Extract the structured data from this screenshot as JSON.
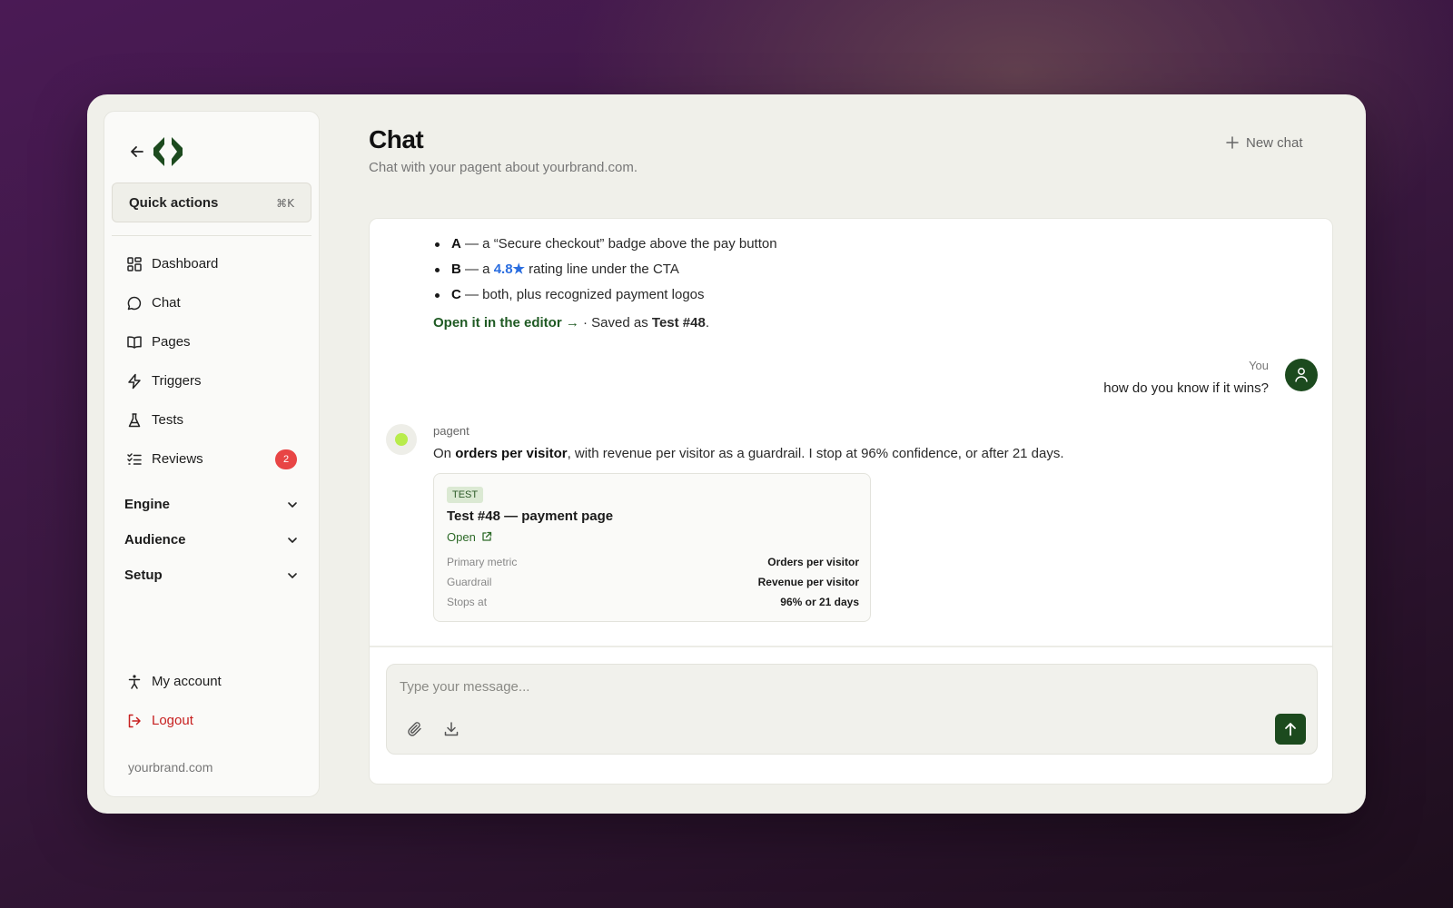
{
  "sidebar": {
    "quick_actions": {
      "label": "Quick actions",
      "shortcut": "⌘K"
    },
    "nav": [
      {
        "label": "Dashboard",
        "icon": "dashboard-icon"
      },
      {
        "label": "Chat",
        "icon": "chat-bubble-icon"
      },
      {
        "label": "Pages",
        "icon": "book-icon"
      },
      {
        "label": "Triggers",
        "icon": "lightning-icon"
      },
      {
        "label": "Tests",
        "icon": "flask-icon"
      },
      {
        "label": "Reviews",
        "icon": "checklist-icon",
        "badge": "2"
      }
    ],
    "sections": [
      {
        "label": "Engine"
      },
      {
        "label": "Audience"
      },
      {
        "label": "Setup"
      }
    ],
    "my_account": "My account",
    "logout": "Logout",
    "domain": "yourbrand.com"
  },
  "header": {
    "title": "Chat",
    "subtitle": "Chat with your pagent about yourbrand.com.",
    "new_chat": "New chat"
  },
  "conversation": {
    "bullets": [
      {
        "key": "A",
        "text": " — a “Secure checkout” badge above the pay button"
      },
      {
        "key": "B",
        "pre": " — a ",
        "highlight": "4.8★",
        "post": " rating line under the CTA"
      },
      {
        "key": "C",
        "text": " — both, plus recognized payment logos"
      }
    ],
    "editor_link": "Open it in the editor →",
    "saved_pre": " · Saved as ",
    "saved_name": "Test #48",
    "saved_post": ".",
    "user": {
      "name": "You",
      "message": "how do you know if it wins?"
    },
    "bot": {
      "name": "pagent",
      "msg_pre": "On ",
      "msg_bold": "orders per visitor",
      "msg_post": ", with revenue per visitor as a guardrail. I stop at 96% confidence, or after 21 days."
    },
    "card": {
      "tag": "TEST",
      "title": "Test #48 — payment page",
      "open": "Open",
      "rows": [
        {
          "key": "Primary metric",
          "value": "Orders per visitor"
        },
        {
          "key": "Guardrail",
          "value": "Revenue per visitor"
        },
        {
          "key": "Stops at",
          "value": "96% or 21 days"
        }
      ]
    }
  },
  "composer": {
    "placeholder": "Type your message...",
    "value": ""
  },
  "colors": {
    "brand_green": "#1c4a1e",
    "logout_red": "#c72020",
    "badge_red": "#e84545",
    "rating_blue": "#2b6ee0"
  }
}
